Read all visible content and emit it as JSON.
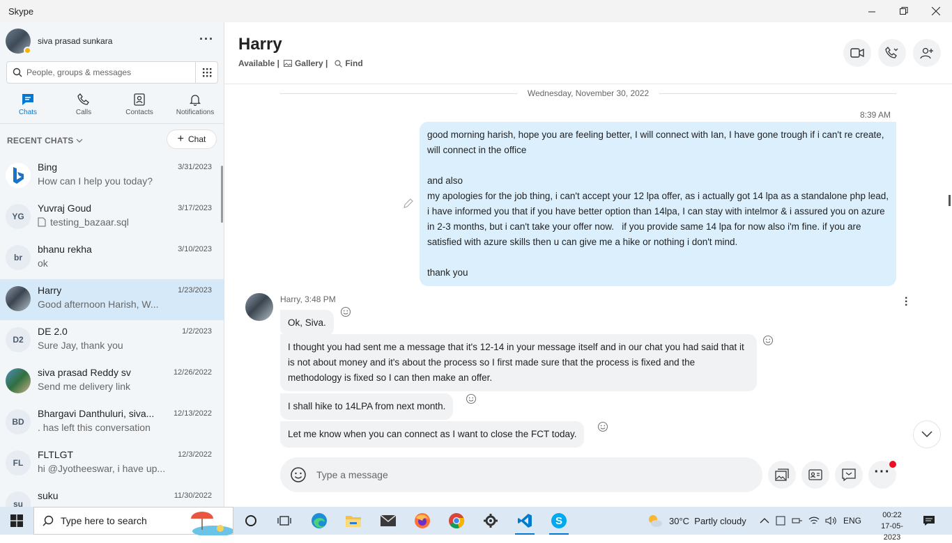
{
  "window": {
    "title": "Skype"
  },
  "profile": {
    "name": "siva prasad sunkara"
  },
  "search": {
    "placeholder": "People, groups & messages"
  },
  "nav": [
    {
      "label": "Chats"
    },
    {
      "label": "Calls"
    },
    {
      "label": "Contacts"
    },
    {
      "label": "Notifications"
    }
  ],
  "recent": {
    "header": "RECENT CHATS",
    "new_chat_label": "Chat"
  },
  "chats": [
    {
      "initials": "",
      "name": "Bing",
      "date": "3/31/2023",
      "preview": "How can I help you today?"
    },
    {
      "initials": "YG",
      "name": "Yuvraj Goud",
      "date": "3/17/2023",
      "preview": "testing_bazaar.sql"
    },
    {
      "initials": "br",
      "name": "bhanu rekha",
      "date": "3/10/2023",
      "preview": "ok"
    },
    {
      "initials": "",
      "name": "Harry",
      "date": "1/23/2023",
      "preview": "Good afternoon Harish, W..."
    },
    {
      "initials": "D2",
      "name": "DE 2.0",
      "date": "1/2/2023",
      "preview": "Sure Jay, thank you"
    },
    {
      "initials": "",
      "name": "siva prasad Reddy sv",
      "date": "12/26/2022",
      "preview": "Send me delivery link"
    },
    {
      "initials": "BD",
      "name": "Bhargavi Danthuluri, siva...",
      "date": "12/13/2022",
      "preview": ". has left this conversation"
    },
    {
      "initials": "FL",
      "name": "FLTLGT",
      "date": "12/3/2022",
      "preview": "hi @Jyotheeswar, i have up..."
    },
    {
      "initials": "su",
      "name": "suku",
      "date": "11/30/2022",
      "preview": ""
    }
  ],
  "conversation": {
    "contact": "Harry",
    "status": "Available |",
    "gallery": "Gallery |",
    "find": "Find",
    "date_separator": "Wednesday, November 30, 2022",
    "outgoing_time": "8:39 AM",
    "outgoing_text": "good morning harish, hope you are feeling better, I will connect with Ian, I have gone trough if i can't re create, will connect in the office\n\nand also\nmy apologies for the job thing, i can't accept your 12 lpa offer, as i actually got 14 lpa as a standalone php lead,  i have informed you that if you have better option than 14lpa, I can stay with intelmor & i assured you on azure in 2-3 months, but i can't take your offer now.   if you provide same 14 lpa for now also i'm fine. if you are satisfied with azure skills then u can give me a hike or nothing i don't mind.\n\nthank you",
    "incoming_meta": "Harry, 3:48 PM",
    "incoming": [
      "Ok, Siva.",
      "I thought you had sent me a message that it's 12-14 in your message itself and in our chat you had said that it is not about money and it's about the process so I first made sure that the process is fixed and the methodology is fixed so I can then make an offer.",
      "I shall hike to 14LPA from next month.",
      "Let me know when you can connect as I want to close the FCT today."
    ],
    "composer_placeholder": "Type a message"
  },
  "taskbar": {
    "search_placeholder": "Type here to search",
    "weather": "30°C  Partly cloudy",
    "lang": "ENG",
    "time": "00:22",
    "date": "17-05-2023"
  },
  "colors": {
    "accent": "#0078d4",
    "outgoing_bubble": "#dceffd",
    "incoming_bubble": "#f1f2f4"
  }
}
